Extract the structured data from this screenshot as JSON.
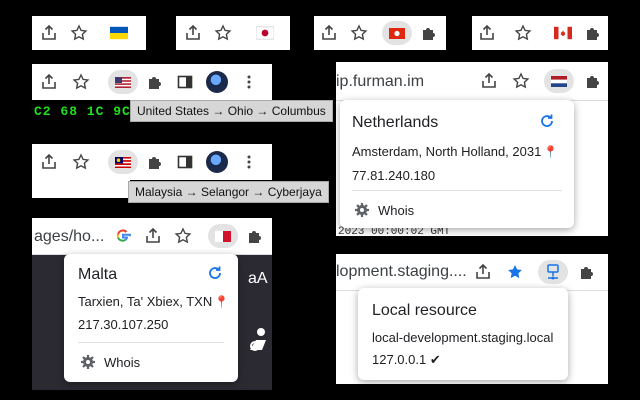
{
  "panels": {
    "ukraine": {
      "flag": "ukraine-flag-icon"
    },
    "japan": {
      "flag": "japan-flag-icon"
    },
    "hongkong": {
      "flag": "hongkong-flag-icon"
    },
    "canada": {
      "flag": "canada-flag-icon"
    },
    "us": {
      "flag": "us-flag-icon",
      "hex": "C2 68 1C 9C",
      "tooltip": "United States → Ohio → Columbus"
    },
    "malaysia": {
      "flag": "malaysia-flag-icon",
      "tooltip": "Malaysia → Selangor → Cyberjaya"
    },
    "netherlands": {
      "url": "ip.furman.im",
      "flag": "netherlands-flag-icon",
      "country": "Netherlands",
      "location": "Amsterdam, North Holland, 2031",
      "ip": "77.81.240.180",
      "whois": "Whois",
      "behind_text": "2023 00:00:02 GMT"
    },
    "malta": {
      "url": "ages/ho...",
      "flag": "malta-flag-icon",
      "country": "Malta",
      "location": "Tarxien, Ta' Xbiex, TXN",
      "ip": "217.30.107.250",
      "whois": "Whois",
      "side_text": "aA"
    },
    "local": {
      "url": "lopment.staging....",
      "icon": "local-network-icon",
      "title": "Local resource",
      "host": "local-development.staging.local",
      "ip": "127.0.0.1 ✔"
    }
  },
  "colors": {
    "pin": "#d93025",
    "refresh": "#1a73e8",
    "star_filled": "#1a73e8",
    "hex": "#1ee01e"
  }
}
